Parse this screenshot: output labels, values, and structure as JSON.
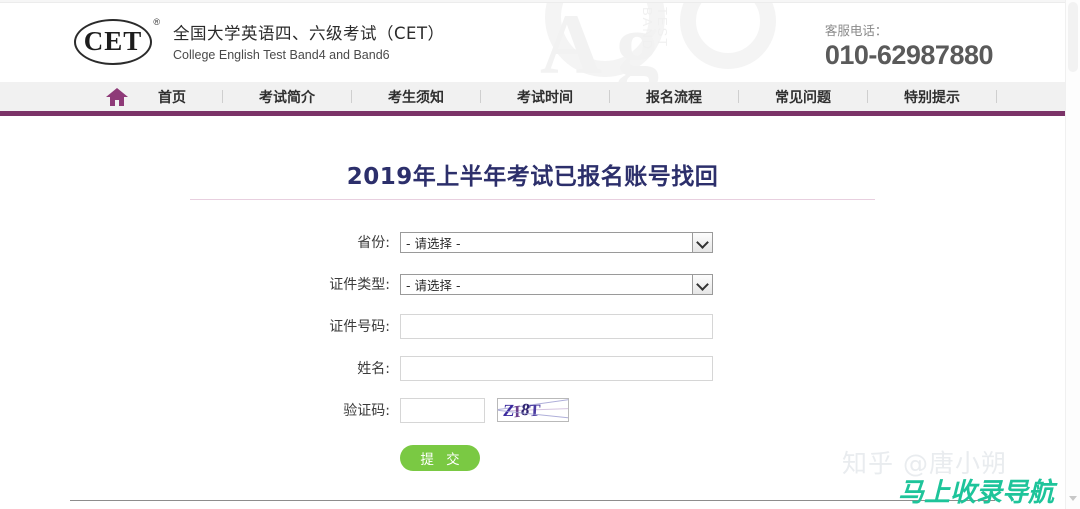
{
  "header": {
    "logo_mark_text": "CET",
    "logo_registered_mark": "®",
    "title_cn": "全国大学英语四、六级考试（CET）",
    "title_en": "College English Test Band4 and Band6",
    "bg_letters": "Ag",
    "bg_vertical_text": "TEST BAND",
    "hotline_label": "客服电话：",
    "hotline_number": "010-62987880"
  },
  "nav": {
    "home_icon": "home-icon",
    "items": [
      {
        "label": "首页"
      },
      {
        "label": "考试简介"
      },
      {
        "label": "考生须知"
      },
      {
        "label": "考试时间"
      },
      {
        "label": "报名流程"
      },
      {
        "label": "常见问题"
      },
      {
        "label": "特别提示"
      }
    ],
    "accent_color": "#7b3368"
  },
  "main": {
    "page_title": "2019年上半年考试已报名账号找回",
    "title_color": "#2c2f6b",
    "form": {
      "province": {
        "label": "省份:",
        "value": "- 请选择 -",
        "control": "select"
      },
      "id_type": {
        "label": "证件类型:",
        "value": "- 请选择 -",
        "control": "select"
      },
      "id_number": {
        "label": "证件号码:",
        "value": "",
        "placeholder": "",
        "control": "text"
      },
      "name": {
        "label": "姓名:",
        "value": "",
        "placeholder": "",
        "control": "text"
      },
      "captcha": {
        "label": "验证码:",
        "value": "",
        "placeholder": "",
        "control": "text",
        "image_chars": [
          "Z",
          "I",
          "8",
          "T"
        ],
        "image_text": "ZI8T"
      },
      "submit_label": "提 交",
      "submit_color": "#7ac943"
    }
  },
  "watermarks": {
    "zhihu": "知乎 @唐小朔",
    "nav_site": "马上收录导航",
    "nav_site_color": "#1ec49a"
  },
  "scrollbar": {
    "up_arrow": "scroll-up-icon",
    "down_arrow": "scroll-down-icon"
  }
}
